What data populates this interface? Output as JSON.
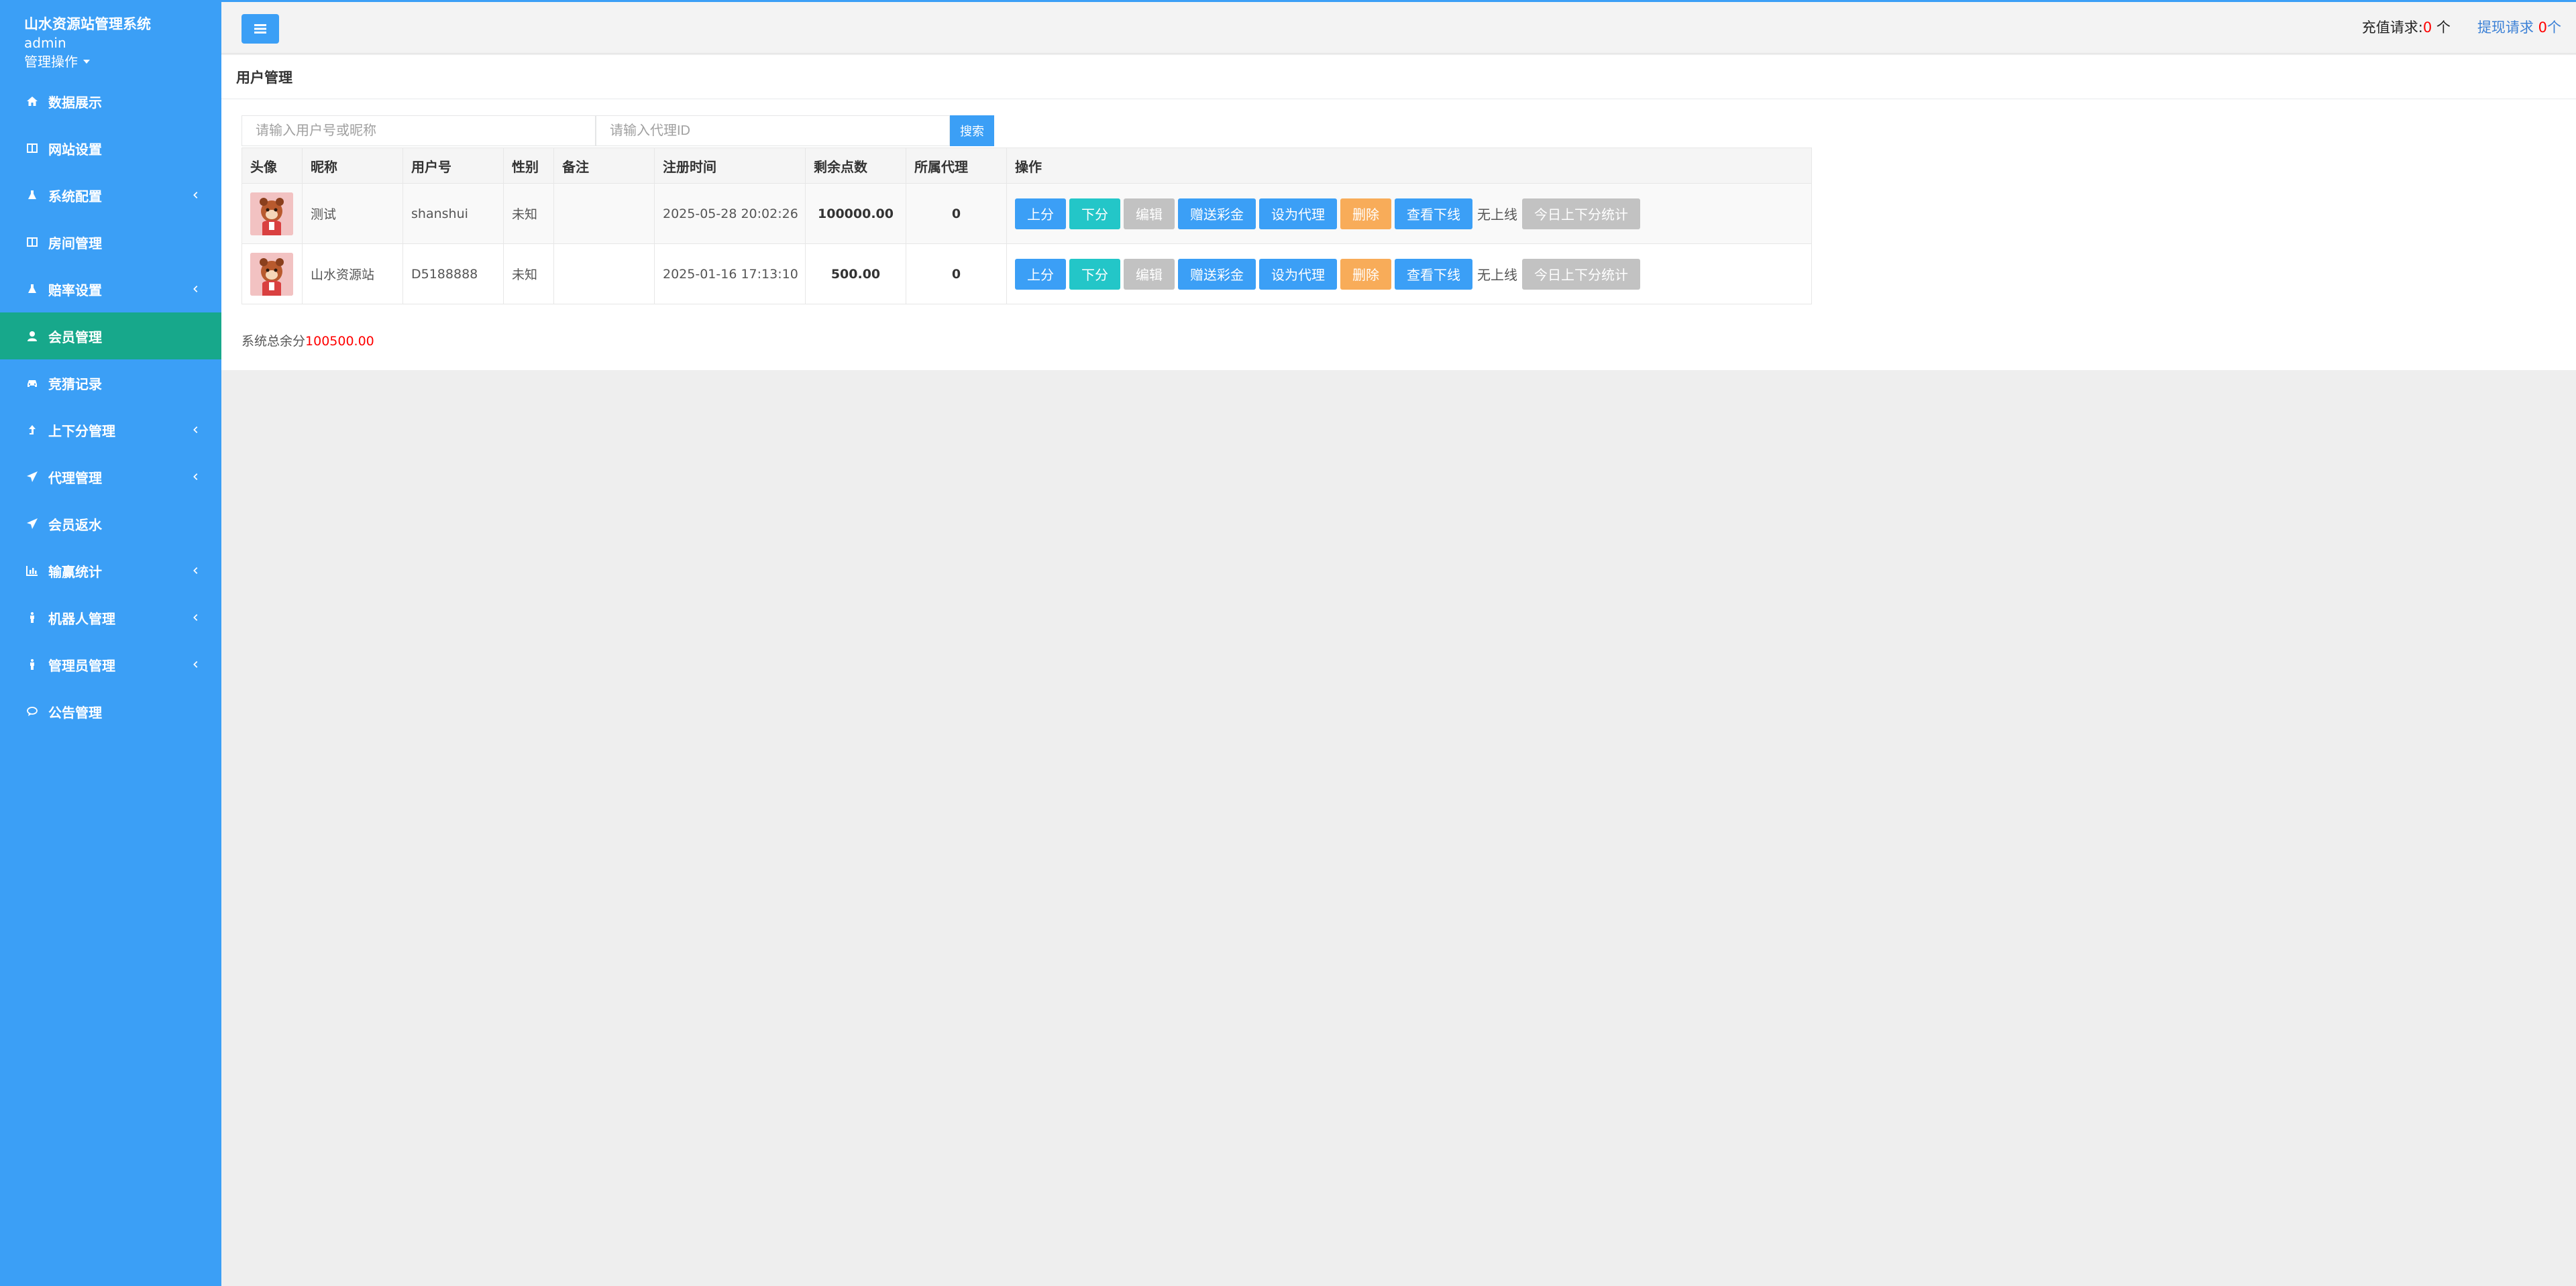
{
  "sidebar": {
    "title": "山水资源站管理系统",
    "user": "admin",
    "ops_label": "管理操作",
    "items": [
      {
        "label": "数据展示",
        "icon": "home-icon",
        "has_sub": false,
        "active": false
      },
      {
        "label": "网站设置",
        "icon": "columns-icon",
        "has_sub": false,
        "active": false
      },
      {
        "label": "系统配置",
        "icon": "flask-icon",
        "has_sub": true,
        "active": false
      },
      {
        "label": "房间管理",
        "icon": "columns-icon",
        "has_sub": false,
        "active": false
      },
      {
        "label": "赔率设置",
        "icon": "flask-icon",
        "has_sub": true,
        "active": false
      },
      {
        "label": "会员管理",
        "icon": "user-icon",
        "has_sub": false,
        "active": true
      },
      {
        "label": "竞猜记录",
        "icon": "car-icon",
        "has_sub": false,
        "active": false
      },
      {
        "label": "上下分管理",
        "icon": "level-up-icon",
        "has_sub": true,
        "active": false
      },
      {
        "label": "代理管理",
        "icon": "paper-plane-icon",
        "has_sub": true,
        "active": false
      },
      {
        "label": "会员返水",
        "icon": "paper-plane-icon",
        "has_sub": false,
        "active": false
      },
      {
        "label": "输赢统计",
        "icon": "bar-chart-icon",
        "has_sub": true,
        "active": false
      },
      {
        "label": "机器人管理",
        "icon": "person-icon",
        "has_sub": true,
        "active": false
      },
      {
        "label": "管理员管理",
        "icon": "person-icon",
        "has_sub": true,
        "active": false
      },
      {
        "label": "公告管理",
        "icon": "comment-icon",
        "has_sub": false,
        "active": false
      }
    ]
  },
  "topbar": {
    "recharge_label": "充值请求:",
    "recharge_count": "0",
    "recharge_unit": " 个",
    "withdraw_label": "提现请求",
    "withdraw_count": "0",
    "withdraw_unit": "个"
  },
  "panel": {
    "title": "用户管理",
    "search_placeholder_user": "请输入用户号或昵称",
    "search_placeholder_agent": "请输入代理ID",
    "search_button": "搜索"
  },
  "table": {
    "headers": [
      "头像",
      "昵称",
      "用户号",
      "性别",
      "备注",
      "注册时间",
      "剩余点数",
      "所属代理",
      "操作"
    ],
    "rows": [
      {
        "nickname": "测试",
        "user_id": "shanshui",
        "gender": "未知",
        "note": "",
        "reg_time": "2025-05-28 20:02:26",
        "points": "100000.00",
        "agent": "0",
        "superior": "无上线"
      },
      {
        "nickname": "山水资源站",
        "user_id": "D5188888",
        "gender": "未知",
        "note": "",
        "reg_time": "2025-01-16 17:13:10",
        "points": "500.00",
        "agent": "0",
        "superior": "无上线"
      }
    ],
    "actions": {
      "up": "上分",
      "down": "下分",
      "edit": "编辑",
      "gift": "赠送彩金",
      "set_agent": "设为代理",
      "delete": "删除",
      "view_downline": "查看下线",
      "today_stats": "今日上下分统计"
    }
  },
  "footer": {
    "total_label": "系统总余分",
    "total_value": "100500.00"
  },
  "colors": {
    "sidebar": "#3b9ff6",
    "active": "#17a88b",
    "blue": "#3b9ff6",
    "teal": "#23c6c8",
    "gray": "#c2c2c2",
    "orange": "#f8ac59",
    "red": "#ff0000"
  }
}
